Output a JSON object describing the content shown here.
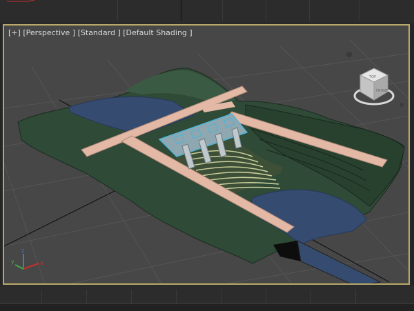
{
  "viewport": {
    "label_plus": "[+]",
    "label_view": "[Perspective ]",
    "label_mode": "[Standard ]",
    "label_shading": "[Default Shading ]"
  },
  "viewcube": {
    "top_label": "TOP",
    "front_label": "FRONT"
  },
  "axis_tripod": {
    "x_label": "x",
    "y_label": "y",
    "z_label": "z"
  },
  "colors": {
    "frame_active": "#b8a96a",
    "viewport_bg": "#474747",
    "terrain": "#2f4a37",
    "water": "#354b6f",
    "road": "#e3b9a6",
    "spillway_stripe": "#c9cf9c",
    "dam_cyan": "#4cb4d8"
  }
}
